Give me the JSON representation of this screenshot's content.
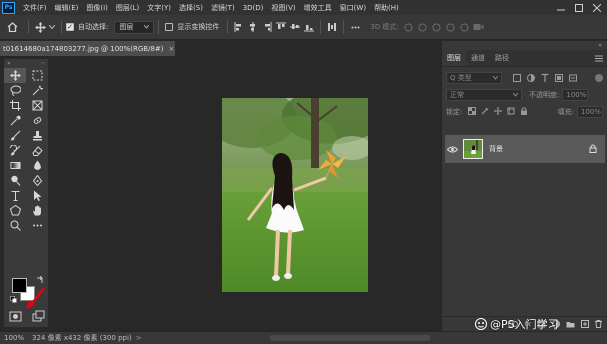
{
  "app": {
    "logo": "Ps"
  },
  "menu": [
    "文件(F)",
    "编辑(E)",
    "图像(I)",
    "图层(L)",
    "文字(Y)",
    "选择(S)",
    "滤镜(T)",
    "3D(D)",
    "视图(V)",
    "增效工具",
    "窗口(W)",
    "帮助(H)"
  ],
  "options": {
    "auto_select_label": "自动选择:",
    "auto_select_value": "图层",
    "transform_label": "显示变换控件",
    "mode_3d": "3D 模式:"
  },
  "document": {
    "tab_title": "t01614680a174803277.jpg @ 100%(RGB/8#)",
    "tab_close": "×"
  },
  "status": {
    "zoom": "100%",
    "info": "324 像素 x432 像素 (300 ppi)",
    "arrow": ">"
  },
  "layers_panel": {
    "tabs": [
      "图层",
      "通道",
      "路径"
    ],
    "filter_label": "Q 类型",
    "blend_mode": "正常",
    "opacity_label": "不透明度:",
    "opacity_value": "100%",
    "lock_label": "锁定:",
    "fill_label": "填充:",
    "fill_value": "100%",
    "layer_name": "背景",
    "footer_icons": [
      "link-icon",
      "fx-icon",
      "mask-icon",
      "adjustment-icon",
      "folder-icon",
      "new-layer-icon",
      "trash-icon"
    ],
    "footer_fx": "fx"
  },
  "watermark": {
    "text": "@PS入门学习"
  },
  "colors": {
    "menubar": "#323232",
    "options_bar": "#383838",
    "canvas_bg": "#282828",
    "active_layer": "#595959",
    "accent": "#31a8ff"
  }
}
